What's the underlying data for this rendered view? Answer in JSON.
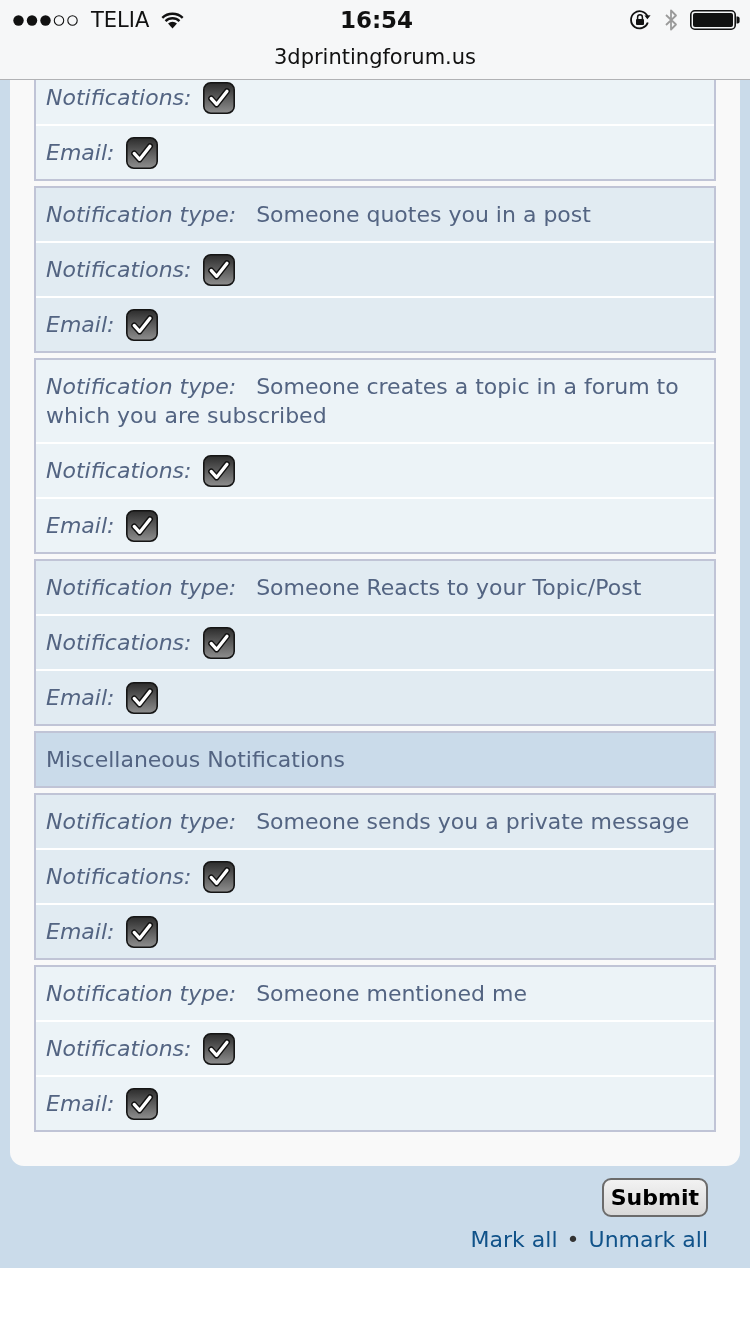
{
  "status_bar": {
    "carrier": "TELIA",
    "time": "16:54"
  },
  "address_bar": {
    "url": "3dprintingforum.us"
  },
  "rows": [
    {
      "kind": "subscription",
      "notifications": {
        "label": "Notifications:",
        "checked": true
      },
      "email": {
        "label": "Email:",
        "checked": true
      }
    },
    {
      "kind": "subscription",
      "notification_type": {
        "label": "Notification type:",
        "value": "Someone quotes you in a post"
      },
      "notifications": {
        "label": "Notifications:",
        "checked": true
      },
      "email": {
        "label": "Email:",
        "checked": true
      }
    },
    {
      "kind": "subscription",
      "notification_type": {
        "label": "Notification type:",
        "value": "Someone creates a topic in a forum to which you are subscribed"
      },
      "notifications": {
        "label": "Notifications:",
        "checked": true
      },
      "email": {
        "label": "Email:",
        "checked": true
      }
    },
    {
      "kind": "subscription",
      "notification_type": {
        "label": "Notification type:",
        "value": "Someone Reacts to your Topic/Post"
      },
      "notifications": {
        "label": "Notifications:",
        "checked": true
      },
      "email": {
        "label": "Email:",
        "checked": true
      }
    },
    {
      "kind": "section_header",
      "title": "Miscellaneous Notifications"
    },
    {
      "kind": "subscription",
      "notification_type": {
        "label": "Notification type:",
        "value": "Someone sends you a private message"
      },
      "notifications": {
        "label": "Notifications:",
        "checked": true
      },
      "email": {
        "label": "Email:",
        "checked": true
      }
    },
    {
      "kind": "subscription",
      "notification_type": {
        "label": "Notification type:",
        "value": "Someone mentioned me"
      },
      "notifications": {
        "label": "Notifications:",
        "checked": true
      },
      "email": {
        "label": "Email:",
        "checked": true
      }
    }
  ],
  "form": {
    "submit": "Submit",
    "links": [
      "Mark all",
      "Unmark all"
    ],
    "separator": "•"
  }
}
